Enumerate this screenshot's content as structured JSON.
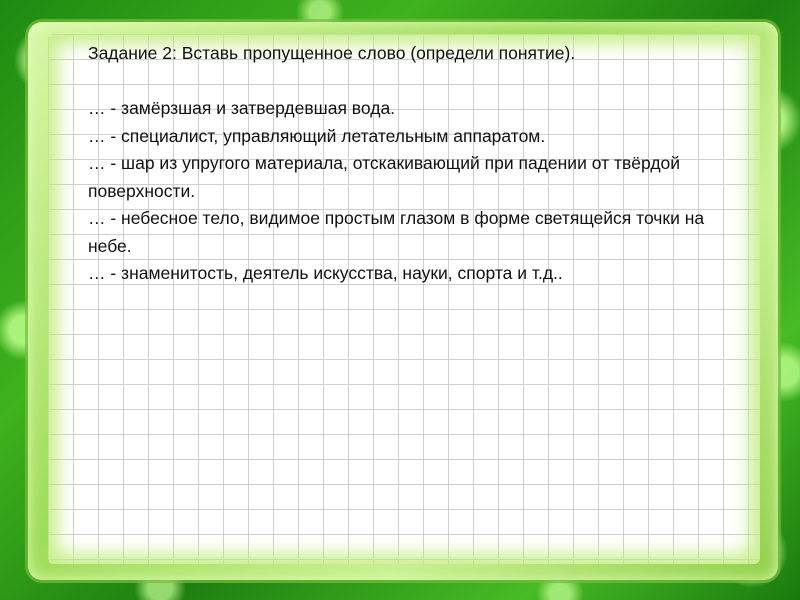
{
  "task": {
    "title": "Задание 2: Вставь пропущенное слово (определи понятие).",
    "items": [
      "… - замёрзшая и затвердевшая вода.",
      "… - специалист, управляющий летательным аппаратом.",
      "… - шар из упругого материала, отскакивающий при падении от твёрдой поверхности.",
      "… - небесное тело, видимое простым глазом в форме светящейся точки на небе.",
      "… - знаменитость, деятель искусства, науки, спорта и т.д.."
    ]
  },
  "colors": {
    "background_green": "#2e9e18",
    "frame_light_green": "#b8ea78",
    "grid_line": "#cfcfcf",
    "text": "#111111"
  }
}
